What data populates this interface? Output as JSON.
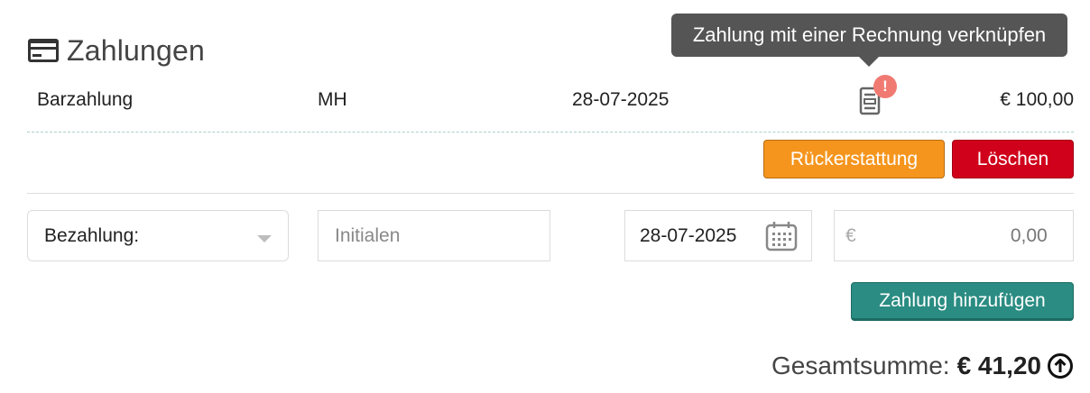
{
  "section": {
    "title": "Zahlungen",
    "icon": "credit-card-icon"
  },
  "tooltip": {
    "text": "Zahlung mit einer Rechnung verknüpfen"
  },
  "payment": {
    "method": "Barzahlung",
    "initials": "MH",
    "date": "28-07-2025",
    "amount": "€ 100,00",
    "invoice_icon": "invoice-document-icon",
    "alert_badge": "!"
  },
  "actions": {
    "refund_label": "Rückerstattung",
    "delete_label": "Löschen"
  },
  "form": {
    "payment_method_label": "Bezahlung:",
    "initials_placeholder": "Initialen",
    "date_value": "28-07-2025",
    "currency_prefix": "€",
    "amount_placeholder": "0,00",
    "add_label": "Zahlung hinzufügen"
  },
  "total": {
    "label": "Gesamtsumme:",
    "value": "€ 41,20",
    "icon": "arrow-up-circle-icon"
  },
  "colors": {
    "refund": "#f5951d",
    "delete": "#d0021b",
    "add": "#2a8c82",
    "tooltip": "#555555",
    "alert": "#f07a72"
  }
}
